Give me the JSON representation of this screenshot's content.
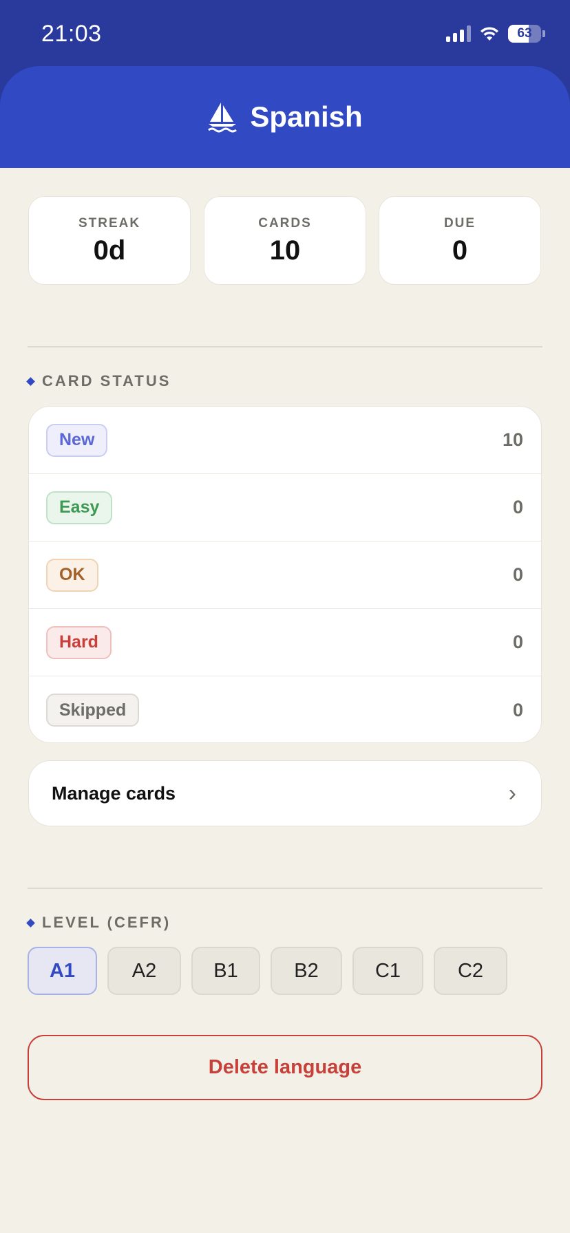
{
  "status_bar": {
    "time": "21:03",
    "battery": "63",
    "battery_level": 0.63
  },
  "header": {
    "title": "Spanish",
    "icon": "sailboat-icon"
  },
  "stats": [
    {
      "label": "STREAK",
      "value": "0d"
    },
    {
      "label": "CARDS",
      "value": "10"
    },
    {
      "label": "DUE",
      "value": "0"
    }
  ],
  "card_status": {
    "title": "CARD STATUS",
    "items": [
      {
        "label": "New",
        "count": "10",
        "color": "#5a66d6",
        "bg": "#eeeffb",
        "border": "#c9cdf1"
      },
      {
        "label": "Easy",
        "count": "0",
        "color": "#3e9a52",
        "bg": "#eaf6ec",
        "border": "#bfe2c7"
      },
      {
        "label": "OK",
        "count": "0",
        "color": "#a3612a",
        "bg": "#fcf1e6",
        "border": "#f0d3b3"
      },
      {
        "label": "Hard",
        "count": "0",
        "color": "#c8403a",
        "bg": "#fbeaea",
        "border": "#eec0bd"
      },
      {
        "label": "Skipped",
        "count": "0",
        "color": "#6e6c66",
        "bg": "#f3f2ef",
        "border": "#dcd9d2"
      }
    ]
  },
  "manage": {
    "label": "Manage cards",
    "chevron": "›"
  },
  "level": {
    "title": "LEVEL (CEFR)",
    "options": [
      "A1",
      "A2",
      "B1",
      "B2",
      "C1",
      "C2"
    ],
    "selected": "A1"
  },
  "delete": {
    "label": "Delete language"
  },
  "colors": {
    "primary": "#3249c4",
    "primary_dark": "#2a3a9c",
    "background": "#f3f0e7",
    "danger": "#c8403a"
  }
}
